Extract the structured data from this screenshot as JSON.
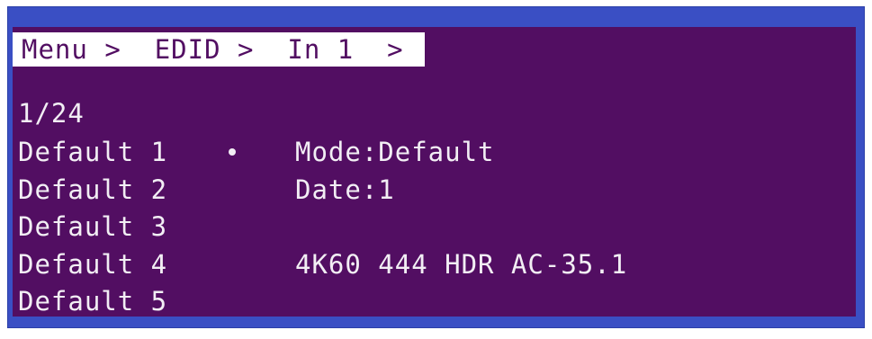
{
  "breadcrumb": {
    "menu": "Menu",
    "edid": "EDID",
    "input": "In 1",
    "separator": ">"
  },
  "page_counter": "1/24",
  "edid_list": [
    {
      "label": "Default 1",
      "selected": true
    },
    {
      "label": "Default 2",
      "selected": false
    },
    {
      "label": "Default 3",
      "selected": false
    },
    {
      "label": "Default 4",
      "selected": false
    },
    {
      "label": "Default 5",
      "selected": false
    }
  ],
  "details": {
    "mode": "Mode:Default",
    "date": "Date:1",
    "blank": "",
    "format": "4K60 444 HDR AC-35.1"
  },
  "colors": {
    "screen_background": "#520e62",
    "frame_border": "#3a4fc4",
    "text": "#f2eef4",
    "breadcrumb_background": "#ffffff"
  }
}
